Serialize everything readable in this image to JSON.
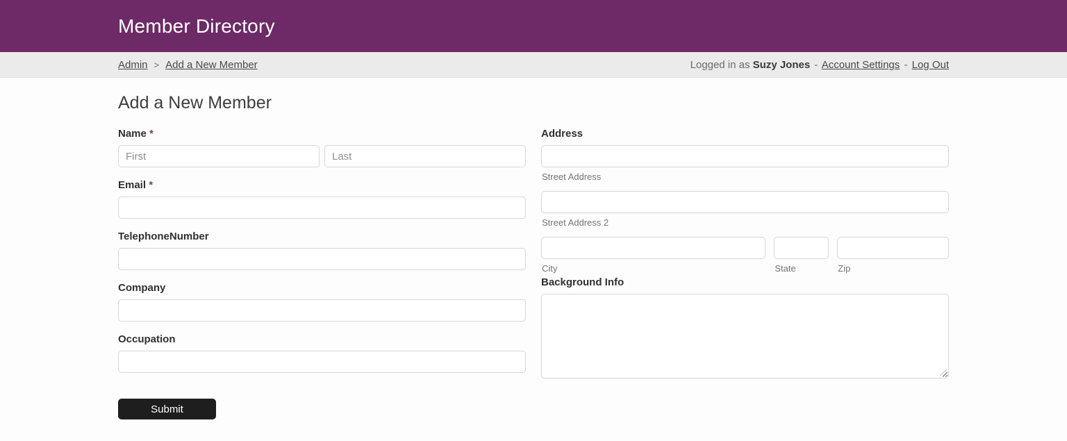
{
  "header": {
    "title": "Member Directory"
  },
  "breadcrumb": {
    "items": [
      {
        "label": "Admin"
      },
      {
        "label": "Add a New Member"
      }
    ],
    "separator": ">",
    "logged_in_prefix": "Logged in as",
    "user_name": "Suzy Jones",
    "dash": "-",
    "links": [
      "Account Settings",
      "Log Out"
    ]
  },
  "form": {
    "title": "Add a New Member",
    "required_marker": "*",
    "fields": {
      "name": {
        "label": "Name",
        "first_placeholder": "First",
        "last_placeholder": "Last",
        "first_value": "",
        "last_value": ""
      },
      "email": {
        "label": "Email",
        "value": ""
      },
      "telephone": {
        "label": "TelephoneNumber",
        "value": ""
      },
      "company": {
        "label": "Company",
        "value": ""
      },
      "occupation": {
        "label": "Occupation",
        "value": ""
      },
      "address": {
        "label": "Address",
        "street_sublabel": "Street Address",
        "street2_sublabel": "Street Address 2",
        "city_sublabel": "City",
        "state_sublabel": "State",
        "zip_sublabel": "Zip",
        "street_value": "",
        "street2_value": "",
        "city_value": "",
        "state_value": "",
        "zip_value": ""
      },
      "background": {
        "label": "Background Info",
        "value": ""
      }
    },
    "submit_label": "Submit"
  },
  "colors": {
    "header_bg": "#6d2a67",
    "breadcrumb_bg": "#ebebeb",
    "required": "#7d3a75",
    "submit_bg": "#1e1e1e"
  }
}
